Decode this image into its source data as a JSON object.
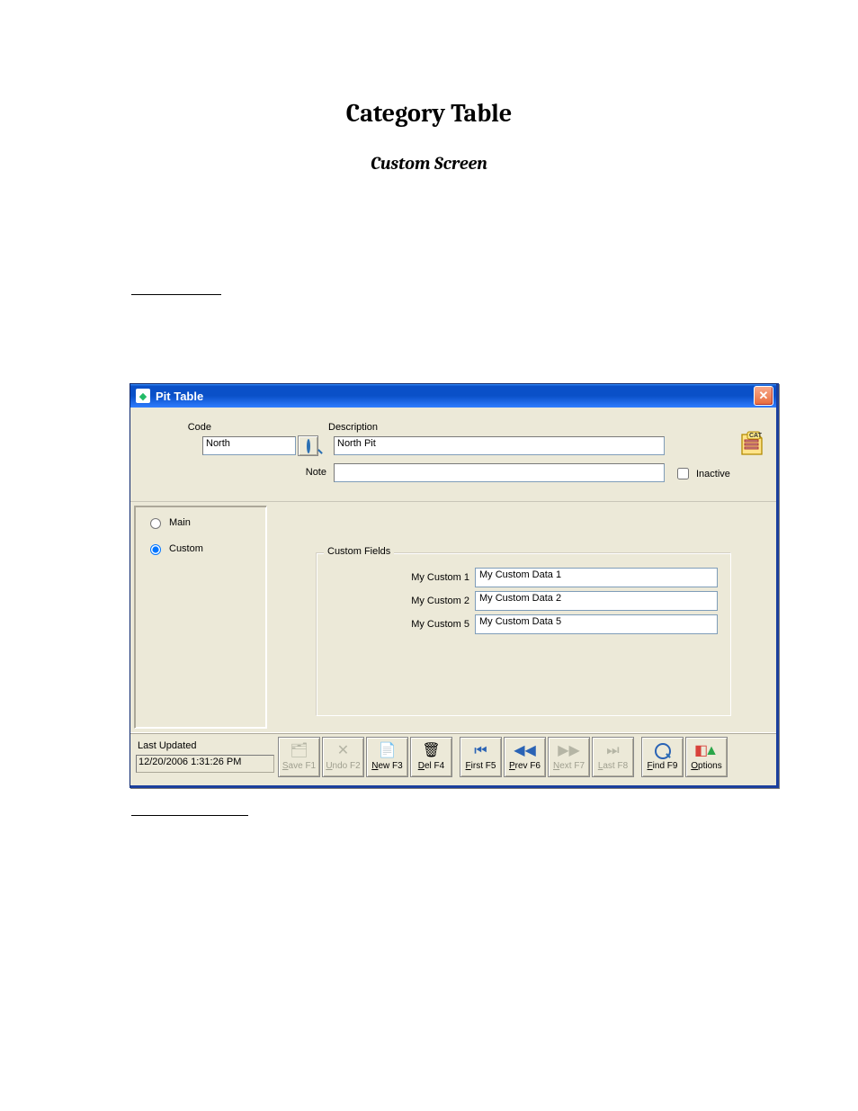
{
  "doc": {
    "title": "Category Table",
    "subtitle": "Custom Screen"
  },
  "window": {
    "title": "Pit Table"
  },
  "form": {
    "code_label": "Code",
    "code_value": "North",
    "description_label": "Description",
    "description_value": "North Pit",
    "note_label": "Note",
    "note_value": "",
    "inactive_label": "Inactive",
    "inactive_checked": false
  },
  "cat_icon_label": "CAT",
  "side": {
    "main_label": "Main",
    "custom_label": "Custom",
    "selected": "custom"
  },
  "customFields": {
    "legend": "Custom Fields",
    "rows": [
      {
        "label": "My Custom 1",
        "value": "My Custom Data 1"
      },
      {
        "label": "My Custom 2",
        "value": "My Custom Data 2"
      },
      {
        "label": "My Custom 5",
        "value": "My Custom Data 5"
      }
    ]
  },
  "lastUpdated": {
    "label": "Last Updated",
    "value": "12/20/2006 1:31:26 PM"
  },
  "toolbar": {
    "save": {
      "label": "Save F1",
      "enabled": false
    },
    "undo": {
      "label": "Undo F2",
      "enabled": false
    },
    "new": {
      "label": "New F3",
      "enabled": true
    },
    "del": {
      "label": "Del F4",
      "enabled": true
    },
    "first": {
      "label": "First F5",
      "enabled": true
    },
    "prev": {
      "label": "Prev F6",
      "enabled": true
    },
    "next": {
      "label": "Next F7",
      "enabled": false
    },
    "last": {
      "label": "Last F8",
      "enabled": false
    },
    "find": {
      "label": "Find F9",
      "enabled": true
    },
    "options": {
      "label": "Options",
      "enabled": true
    }
  }
}
